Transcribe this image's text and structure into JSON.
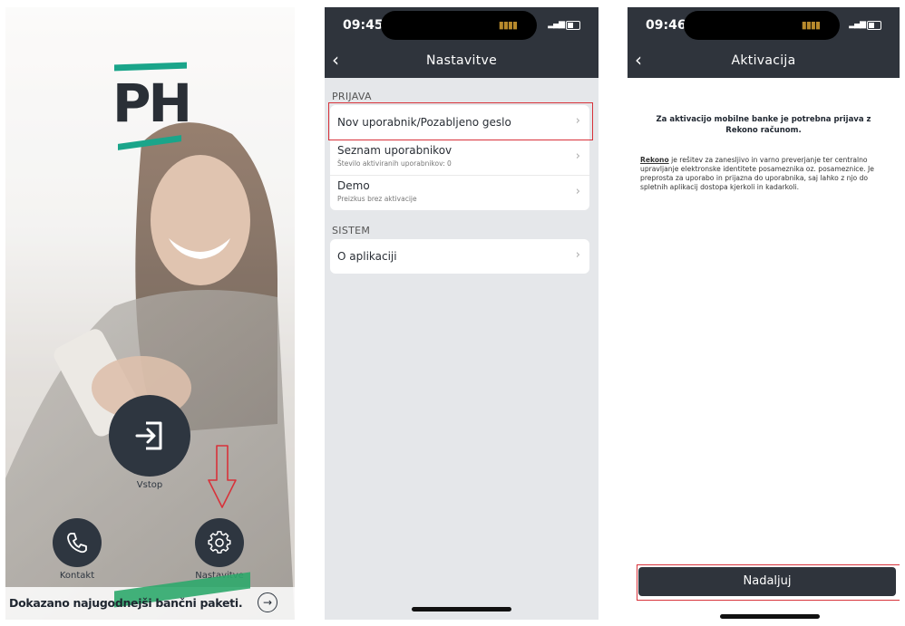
{
  "screen1": {
    "logo_text": "PH",
    "login_label": "Vstop",
    "contact_label": "Kontakt",
    "settings_label": "Nastavitve",
    "promo_text": "Dokazano najugodnejši bančni paketi.",
    "brand_color": "#1aa58a",
    "button_color": "#2e3640",
    "annotation_color": "#d8323a"
  },
  "screen2": {
    "time": "09:45",
    "title": "Nastavitve",
    "section_login": "PRIJAVA",
    "items_login": [
      {
        "title": "Nov uporabnik/Pozabljeno geslo",
        "subtitle": ""
      },
      {
        "title": "Seznam uporabnikov",
        "subtitle": "Število aktiviranih uporabnikov: 0"
      },
      {
        "title": "Demo",
        "subtitle": "Preizkus brez aktivacije"
      }
    ],
    "section_system": "SISTEM",
    "items_system": [
      {
        "title": "O aplikaciji",
        "subtitle": ""
      }
    ]
  },
  "screen3": {
    "time": "09:46",
    "title": "Aktivacija",
    "heading": "Za aktivacijo mobilne banke je potrebna prijava z Rekono računom.",
    "link_word": "Rekono",
    "body": " je rešitev za zanesljivo in varno preverjanje ter centralno upravljanje elektronske identitete posameznika oz. posameznice. Je preprosta za uporabo in prijazna do uporabnika, saj lahko z njo do spletnih aplikacij dostopa kjerkoli in kadarkoli.",
    "button_label": "Nadaljuj"
  }
}
